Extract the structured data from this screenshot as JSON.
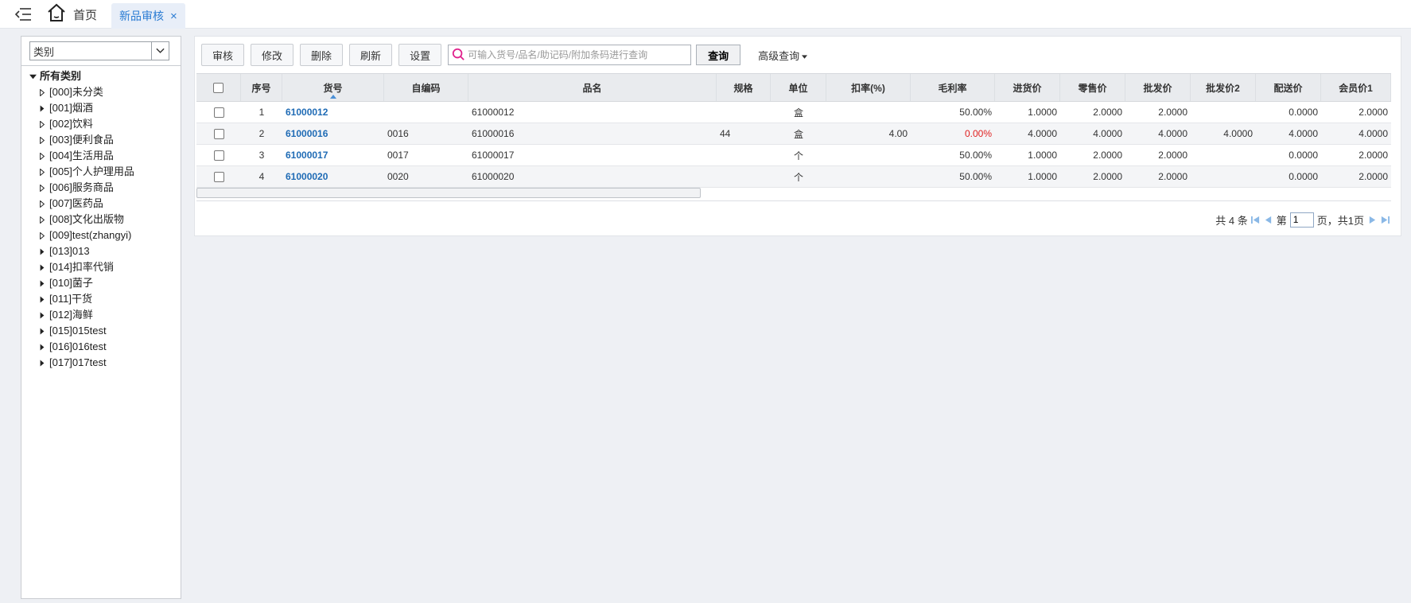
{
  "tabs": {
    "home_label": "首页",
    "active_label": "新品审核",
    "close_glyph": "×"
  },
  "category_panel": {
    "select_value": "类别",
    "root_label": "所有类别",
    "items": [
      "[000]未分类",
      "[001]烟酒",
      "[002]饮料",
      "[003]便利食品",
      "[004]生活用品",
      "[005]个人护理用品",
      "[006]服务商品",
      "[007]医药品",
      "[008]文化出版物",
      "[009]test(zhangyi)",
      "[013]013",
      "[014]扣率代销",
      "[010]菌子",
      "[011]干货",
      "[012]海鲜",
      "[015]015test",
      "[016]016test",
      "[017]017test"
    ]
  },
  "toolbar": {
    "audit_label": "审核",
    "edit_label": "修改",
    "delete_label": "删除",
    "refresh_label": "刷新",
    "settings_label": "设置",
    "search_placeholder": "可输入货号/品名/助记码/附加条码进行查询",
    "query_label": "查询",
    "advanced_label": "高级查询"
  },
  "grid": {
    "headers": {
      "seq": "序号",
      "code": "货号",
      "self_code": "自编码",
      "name": "品名",
      "spec": "规格",
      "unit": "单位",
      "discount": "扣率(%)",
      "gross": "毛利率",
      "buy": "进货价",
      "retail": "零售价",
      "wholesale": "批发价",
      "wholesale2": "批发价2",
      "distribution": "配送价",
      "member": "会员价1"
    },
    "rows": [
      {
        "seq": "1",
        "code": "61000012",
        "self_code": "",
        "name": "61000012",
        "spec": "",
        "unit": "盒",
        "discount": "",
        "gross": "50.00%",
        "buy": "1.0000",
        "retail": "2.0000",
        "wholesale": "2.0000",
        "wholesale2": "",
        "distribution": "0.0000",
        "member": "2.0000"
      },
      {
        "seq": "2",
        "code": "61000016",
        "self_code": "0016",
        "name": "61000016",
        "spec": "44",
        "unit": "盒",
        "discount": "4.00",
        "gross": "0.00%",
        "buy": "4.0000",
        "retail": "4.0000",
        "wholesale": "4.0000",
        "wholesale2": "4.0000",
        "distribution": "4.0000",
        "member": "4.0000"
      },
      {
        "seq": "3",
        "code": "61000017",
        "self_code": "0017",
        "name": "61000017",
        "spec": "",
        "unit": "个",
        "discount": "",
        "gross": "50.00%",
        "buy": "1.0000",
        "retail": "2.0000",
        "wholesale": "2.0000",
        "wholesale2": "",
        "distribution": "0.0000",
        "member": "2.0000"
      },
      {
        "seq": "4",
        "code": "61000020",
        "self_code": "0020",
        "name": "61000020",
        "spec": "",
        "unit": "个",
        "discount": "",
        "gross": "50.00%",
        "buy": "1.0000",
        "retail": "2.0000",
        "wholesale": "2.0000",
        "wholesale2": "",
        "distribution": "0.0000",
        "member": "2.0000"
      }
    ]
  },
  "pager": {
    "total_text": "共 4 条",
    "page_prefix": "第",
    "current_page": "1",
    "page_suffix": "页，共1页"
  },
  "colors": {
    "accent": "#2b7cd3",
    "link": "#1f6bb5",
    "negative": "#e02020"
  }
}
